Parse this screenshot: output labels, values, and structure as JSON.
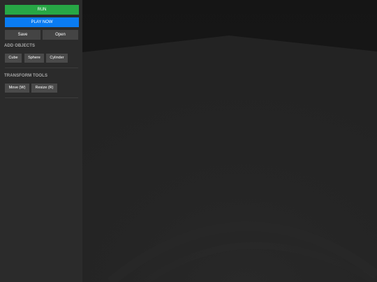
{
  "toolbar": {
    "run_label": "RUN",
    "play_now_label": "PLAY NOW",
    "save_label": "Save",
    "open_label": "Open"
  },
  "add_objects": {
    "title": "ADD OBJECTS",
    "items": [
      {
        "label": "Cube"
      },
      {
        "label": "Sphere"
      },
      {
        "label": "Cylinder"
      }
    ]
  },
  "transform_tools": {
    "title": "TRANSFORM TOOLS",
    "items": [
      {
        "label": "Move (W)"
      },
      {
        "label": "Resize (R)"
      }
    ]
  },
  "colors": {
    "run_button": "#27a745",
    "play_button": "#0a7cf2",
    "sidebar_bg": "#2b2b2b",
    "viewport_sky": "#181818",
    "viewport_floor": "#262626"
  }
}
